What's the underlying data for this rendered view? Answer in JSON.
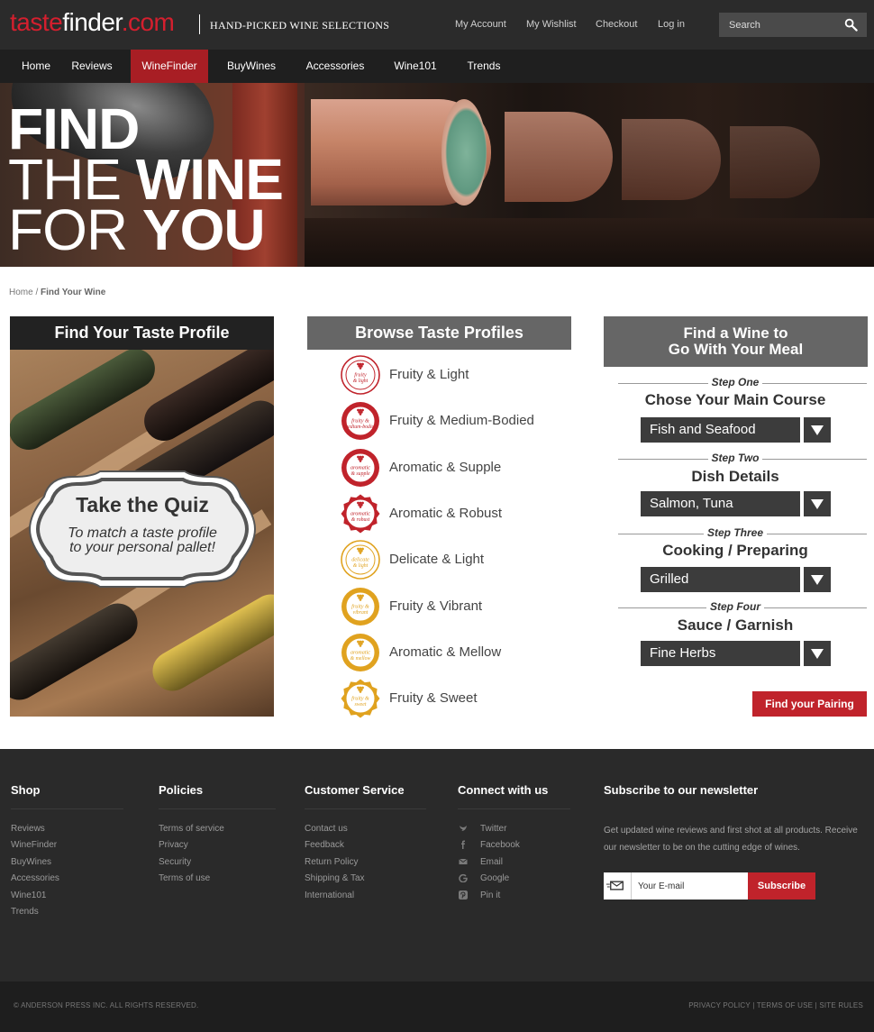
{
  "header": {
    "logo": {
      "part1": "taste",
      "part2": "finder",
      "part3": ".com"
    },
    "tagline": "HAND-PICKED WINE SELECTIONS",
    "links": [
      "My Account",
      "My Wishlist",
      "Checkout",
      "Log in"
    ],
    "search_placeholder": "Search"
  },
  "nav": {
    "items": [
      "Home",
      "Reviews",
      "WineFinder",
      "BuyWines",
      "Accessories",
      "Wine101",
      "Trends"
    ],
    "active": "WineFinder"
  },
  "hero": {
    "line1": "FIND",
    "line2_thin": "THE ",
    "line2_bold": "WINE",
    "line3_thin": "FOR ",
    "line3_bold": "YOU"
  },
  "breadcrumb": {
    "home": "Home",
    "sep": " / ",
    "current": "Find Your Wine"
  },
  "quiz": {
    "heading": "Find Your Taste Profile",
    "title": "Take the Quiz",
    "subtitle_line1": "To match a taste profile",
    "subtitle_line2": "to your personal pallet!"
  },
  "browse": {
    "heading": "Browse Taste Profiles",
    "profiles": [
      {
        "label": "Fruity & Light",
        "badge_line1": "fruity",
        "badge_line2": "& light",
        "color": "#c0232b",
        "variant": "red-plain"
      },
      {
        "label": "Fruity & Medium-Bodied",
        "badge_line1": "fruity &",
        "badge_line2": "medium-bodied",
        "color": "#c0232b",
        "variant": "red-solid"
      },
      {
        "label": "Aromatic & Supple",
        "badge_line1": "aromatic",
        "badge_line2": "& supple",
        "color": "#c0232b",
        "variant": "red-solid"
      },
      {
        "label": "Aromatic & Robust",
        "badge_line1": "aromatic",
        "badge_line2": "& robust",
        "color": "#c0232b",
        "variant": "red-star"
      },
      {
        "label": "Delicate & Light",
        "badge_line1": "delicate",
        "badge_line2": "& light",
        "color": "#e0a21f",
        "variant": "gold-plain"
      },
      {
        "label": "Fruity & Vibrant",
        "badge_line1": "fruity &",
        "badge_line2": "vibrant",
        "color": "#e0a21f",
        "variant": "gold-solid"
      },
      {
        "label": "Aromatic & Mellow",
        "badge_line1": "aromatic",
        "badge_line2": "& mellow",
        "color": "#e0a21f",
        "variant": "gold-solid"
      },
      {
        "label": "Fruity & Sweet",
        "badge_line1": "fruity &",
        "badge_line2": "sweet",
        "color": "#e0a21f",
        "variant": "gold-star"
      }
    ]
  },
  "pairing": {
    "heading_line1": "Find a Wine to",
    "heading_line2": "Go With Your Meal",
    "steps": [
      {
        "label": "Step One",
        "title": "Chose Your Main Course",
        "value": "Fish and Seafood"
      },
      {
        "label": "Step Two",
        "title": "Dish Details",
        "value": "Salmon, Tuna"
      },
      {
        "label": "Step Three",
        "title": "Cooking / Preparing",
        "value": "Grilled"
      },
      {
        "label": "Step Four",
        "title": "Sauce / Garnish",
        "value": "Fine Herbs"
      }
    ],
    "button": "Find your Pairing"
  },
  "footer": {
    "shop": {
      "heading": "Shop",
      "links": [
        "Reviews",
        "WineFinder",
        "BuyWines",
        "Accessories",
        "Wine101",
        "Trends"
      ]
    },
    "policies": {
      "heading": "Policies",
      "links": [
        "Terms of service",
        "Privacy",
        "Security",
        "Terms of use"
      ]
    },
    "service": {
      "heading": "Customer Service",
      "links": [
        "Contact us",
        "Feedback",
        "Return Policy",
        "Shipping & Tax",
        "International"
      ]
    },
    "connect": {
      "heading": "Connect with us",
      "links": [
        {
          "label": "Twitter",
          "icon": "twitter-icon"
        },
        {
          "label": "Facebook",
          "icon": "facebook-icon"
        },
        {
          "label": "Email",
          "icon": "email-icon"
        },
        {
          "label": "Google",
          "icon": "google-icon"
        },
        {
          "label": "Pin it",
          "icon": "pinterest-icon"
        }
      ]
    },
    "newsletter": {
      "heading": "Subscribe to our newsletter",
      "text": "Get updated wine reviews and first shot at all products. Receive our newsletter to be on the cutting edge of wines.",
      "placeholder": "Your E-mail",
      "button": "Subscribe"
    },
    "copyright": "© ANDERSON PRESS INC.   ALL RIGHTS RESERVED.",
    "legal": [
      "PRIVACY POLICY",
      "TERMS OF USE",
      "SITE RULES"
    ]
  }
}
